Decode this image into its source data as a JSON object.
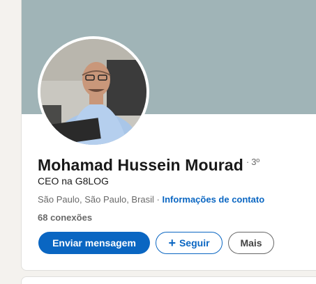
{
  "profile": {
    "name": "Mohamad Hussein Mourad",
    "degree_dot": "·",
    "degree": "3º",
    "headline": "CEO na G8LOG",
    "location": "São Paulo, São Paulo, Brasil",
    "separator": " · ",
    "contact_info_link": "Informações de contato",
    "connections": "68 conexões"
  },
  "actions": {
    "message_label": "Enviar mensagem",
    "follow_icon": "+",
    "follow_label": "Seguir",
    "more_label": "Mais"
  },
  "colors": {
    "banner": "#a0b4b7",
    "primary": "#0a66c2",
    "background": "#f4f2ee"
  },
  "icons": {
    "follow": "plus-icon",
    "avatar": "profile-photo"
  }
}
